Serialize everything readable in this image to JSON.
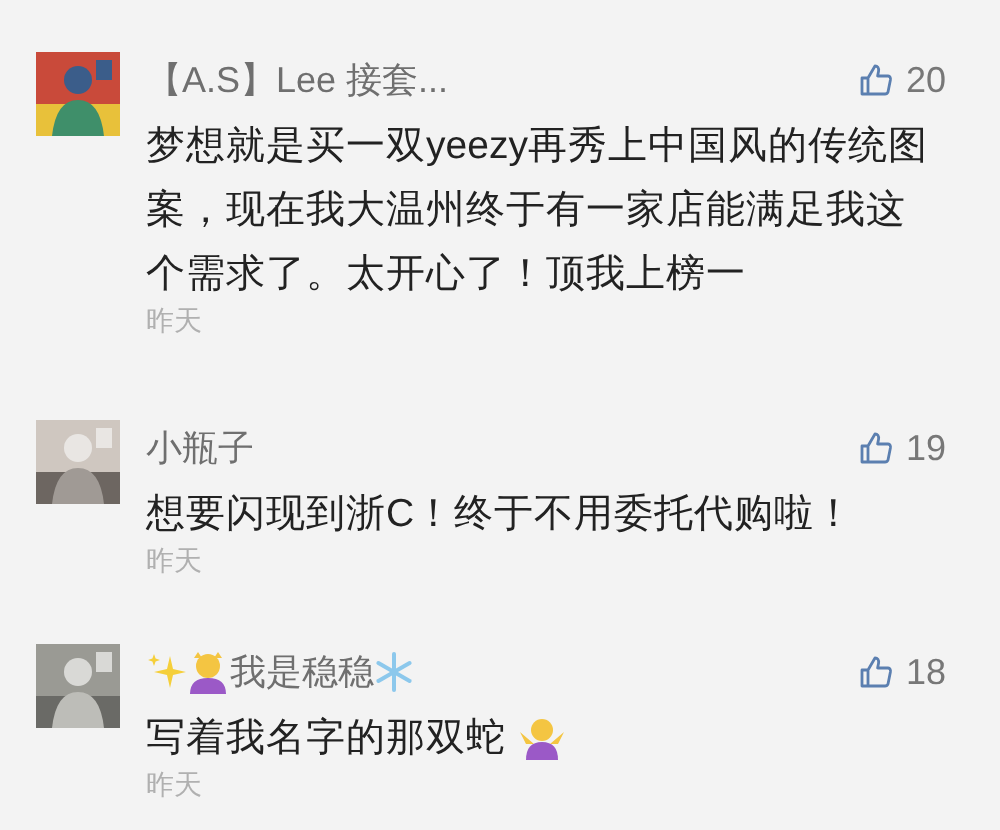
{
  "comments": [
    {
      "avatar": {
        "kind": "picture"
      },
      "name": "【A.S】Lee 接套...",
      "likes": "20",
      "text": "梦想就是买一双yeezy再秀上中国风的传统图案，现在我大温州终于有一家店能满足我这个需求了。太开心了！顶我上榜一",
      "time": "昨天"
    },
    {
      "avatar": {
        "kind": "picture"
      },
      "name": "小瓶子",
      "likes": "19",
      "text": "想要闪现到浙C！终于不用委托代购啦！",
      "time": "昨天"
    },
    {
      "avatar": {
        "kind": "picture"
      },
      "name_prefix": [
        {
          "kind": "sparkles"
        },
        {
          "kind": "person"
        }
      ],
      "name": "我是稳稳",
      "name_suffix": {
        "kind": "snowflake"
      },
      "likes": "18",
      "text": "写着我名字的那双蛇",
      "text_suffix": {
        "kind": "shrug"
      },
      "time": "昨天"
    }
  ]
}
